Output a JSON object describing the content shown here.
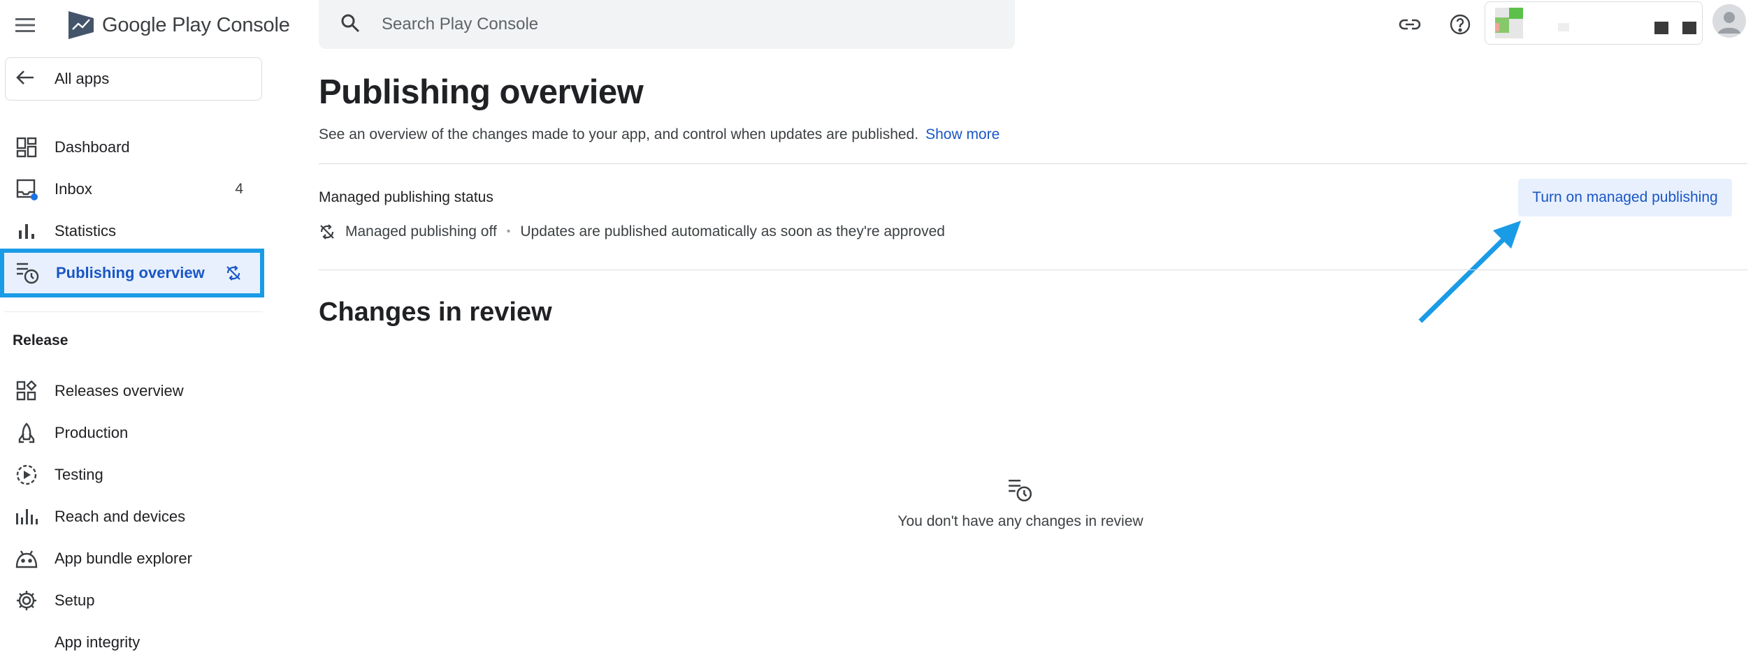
{
  "brand": {
    "name": "Google Play Console"
  },
  "search": {
    "placeholder": "Search Play Console"
  },
  "sidebar": {
    "all_apps_label": "All apps",
    "items": [
      {
        "label": "Dashboard"
      },
      {
        "label": "Inbox",
        "count": "4"
      },
      {
        "label": "Statistics"
      },
      {
        "label": "Publishing overview"
      }
    ],
    "release_section_label": "Release",
    "release_items": [
      {
        "label": "Releases overview"
      },
      {
        "label": "Production"
      },
      {
        "label": "Testing"
      },
      {
        "label": "Reach and devices"
      },
      {
        "label": "App bundle explorer"
      },
      {
        "label": "Setup"
      },
      {
        "label": "App integrity"
      }
    ]
  },
  "main": {
    "title": "Publishing overview",
    "description": "See an overview of the changes made to your app, and control when updates are published.",
    "show_more": "Show more",
    "managed_status_heading": "Managed publishing status",
    "managed_status_value": "Managed publishing off",
    "managed_status_detail": "Updates are published automatically as soon as they're approved",
    "turn_on_button": "Turn on managed publishing",
    "changes_title": "Changes in review",
    "empty_text": "You don't have any changes in review"
  },
  "colors": {
    "accent": "#1a56c4",
    "highlight_box": "#1a9be6",
    "active_bg": "#e8f0fe",
    "annotation_arrow": "#1a9be6"
  },
  "icons": [
    "menu-icon",
    "play-console-logo",
    "arrow-back-icon",
    "dashboard-icon",
    "inbox-icon",
    "bar-chart-icon",
    "publishing-icon",
    "sync-off-icon",
    "releases-icon",
    "production-icon",
    "testing-icon",
    "reach-icon",
    "bundle-icon",
    "gear-icon",
    "search-icon",
    "link-icon",
    "help-icon",
    "avatar"
  ]
}
